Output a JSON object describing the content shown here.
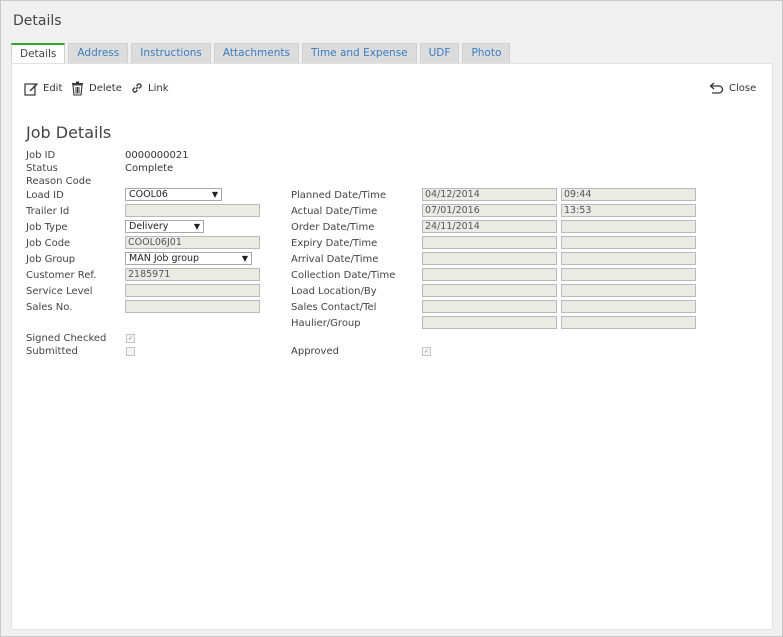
{
  "window": {
    "title": "Details"
  },
  "tabs": [
    {
      "label": "Details"
    },
    {
      "label": "Address"
    },
    {
      "label": "Instructions"
    },
    {
      "label": "Attachments"
    },
    {
      "label": "Time and Expense"
    },
    {
      "label": "UDF"
    },
    {
      "label": "Photo"
    }
  ],
  "toolbar": {
    "edit": "Edit",
    "delete": "Delete",
    "link": "Link",
    "close": "Close"
  },
  "section_title": "Job Details",
  "fields": {
    "job_id": {
      "label": "Job ID",
      "value": "0000000021"
    },
    "status": {
      "label": "Status",
      "value": "Complete"
    },
    "reason_code": {
      "label": "Reason Code",
      "value": ""
    },
    "load_id": {
      "label": "Load ID",
      "value": "COOL06"
    },
    "trailer_id": {
      "label": "Trailer Id",
      "value": ""
    },
    "job_type": {
      "label": "Job Type",
      "value": "Delivery"
    },
    "job_code": {
      "label": "Job Code",
      "value": "COOL06J01"
    },
    "job_group": {
      "label": "Job Group",
      "value": "MAN Job group"
    },
    "customer_ref": {
      "label": "Customer Ref.",
      "value": "2185971"
    },
    "service_level": {
      "label": "Service Level",
      "value": ""
    },
    "sales_no": {
      "label": "Sales No.",
      "value": ""
    },
    "signed_checked": {
      "label": "Signed Checked",
      "checked": true
    },
    "submitted": {
      "label": "Submitted",
      "checked": false
    },
    "approved": {
      "label": "Approved",
      "checked": true
    }
  },
  "right_fields": {
    "planned": {
      "label": "Planned Date/Time",
      "date": "04/12/2014",
      "time": "09:44"
    },
    "actual": {
      "label": "Actual Date/Time",
      "date": "07/01/2016",
      "time": "13:53"
    },
    "order": {
      "label": "Order Date/Time",
      "date": "24/11/2014",
      "time": ""
    },
    "expiry": {
      "label": "Expiry Date/Time",
      "date": "",
      "time": ""
    },
    "arrival": {
      "label": "Arrival Date/Time",
      "date": "",
      "time": ""
    },
    "collection": {
      "label": "Collection Date/Time",
      "date": "",
      "time": ""
    },
    "load_location": {
      "label": "Load Location/By",
      "date": "",
      "time": ""
    },
    "sales_contact": {
      "label": "Sales Contact/Tel",
      "date": "",
      "time": ""
    },
    "haulier": {
      "label": "Haulier/Group",
      "date": "",
      "time": ""
    }
  },
  "icons": {
    "edit": "edit-icon",
    "delete": "trash-icon",
    "link": "link-icon",
    "close": "undo-arrow-icon"
  },
  "colors": {
    "active_tab_border": "#2fa22f",
    "tab_text": "#3a7cc1"
  }
}
